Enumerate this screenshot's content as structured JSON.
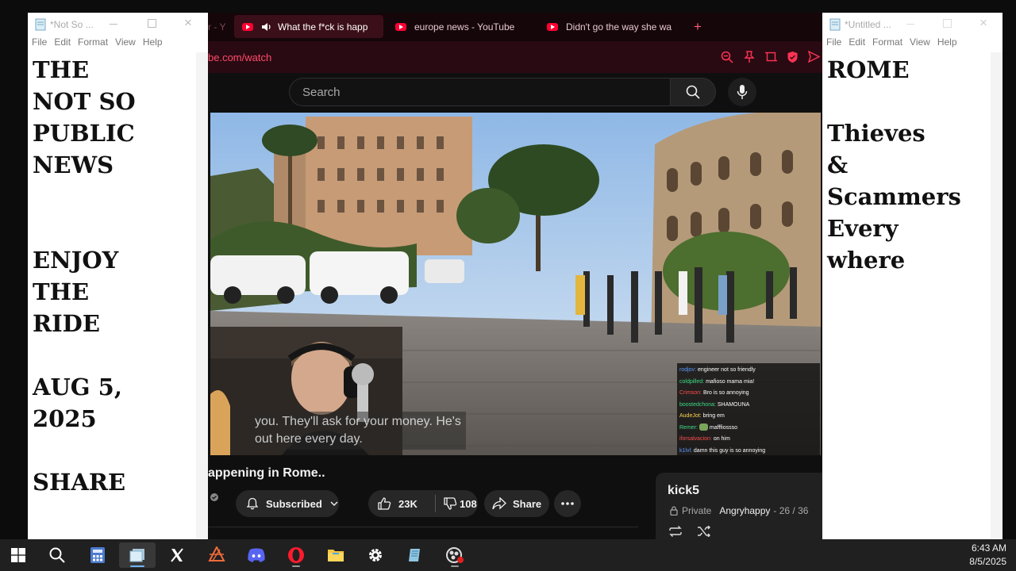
{
  "left_notepad": {
    "title": "*Not So ...",
    "menu": [
      "File",
      "Edit",
      "Format",
      "View",
      "Help"
    ],
    "lines": [
      "THE",
      "NOT SO",
      "PUBLIC",
      "NEWS",
      "",
      "",
      "ENJOY",
      "THE",
      "RIDE",
      "",
      "AUG 5,",
      "2025",
      "",
      "SHARE"
    ]
  },
  "right_notepad": {
    "title": "*Untitled ...",
    "menu": [
      "File",
      "Edit",
      "Format",
      "View",
      "Help"
    ],
    "lines": [
      "ROME",
      "",
      "Thieves",
      "&",
      "Scammers",
      "Every",
      "where"
    ]
  },
  "browser": {
    "tabs": [
      {
        "label": "r - Y",
        "active": false
      },
      {
        "label": "What the f*ck is happ",
        "active": true
      },
      {
        "label": "europe news - YouTube",
        "active": false
      },
      {
        "label": "Didn't go the way she wa",
        "active": false
      }
    ],
    "new_tab": "+",
    "url": "be.com/watch",
    "search_placeholder": "Search",
    "video_title": "appening in Rome..",
    "subscribed_label": "Subscribed",
    "likes": "23K",
    "dislikes": "108",
    "share_label": "Share",
    "captions": [
      "you. They'll ask for your money. He's",
      "out here every day."
    ],
    "chat": [
      {
        "user": "rodjov:",
        "msg": "engineer not so friendly",
        "color": "#5b9bff"
      },
      {
        "user": "coldpilled:",
        "msg": "mafioso mama mia!",
        "color": "#3ddc84"
      },
      {
        "user": "Crimson:",
        "msg": "Bro is so annoying",
        "color": "#ff4d4d"
      },
      {
        "user": "boostedchona:",
        "msg": "SHAMOUNA",
        "color": "#3ddc84"
      },
      {
        "user": "AudeJot:",
        "msg": "bring em",
        "color": "#ffd54f"
      },
      {
        "user": "Remer:",
        "msg": "mafffiossso",
        "color": "#3ddc84"
      },
      {
        "user": "iforsalvacion:",
        "msg": "on him",
        "color": "#ff4d4d"
      },
      {
        "user": "k1lvl:",
        "msg": "damn this guy is so annoying",
        "color": "#5b9bff"
      }
    ],
    "playlist": {
      "title": "kick5",
      "privacy": "Private",
      "owner": "Angryhappy",
      "position": "- 26 / 36"
    }
  },
  "taskbar": {
    "time": "6:43 AM",
    "date": "8/5/2025"
  }
}
